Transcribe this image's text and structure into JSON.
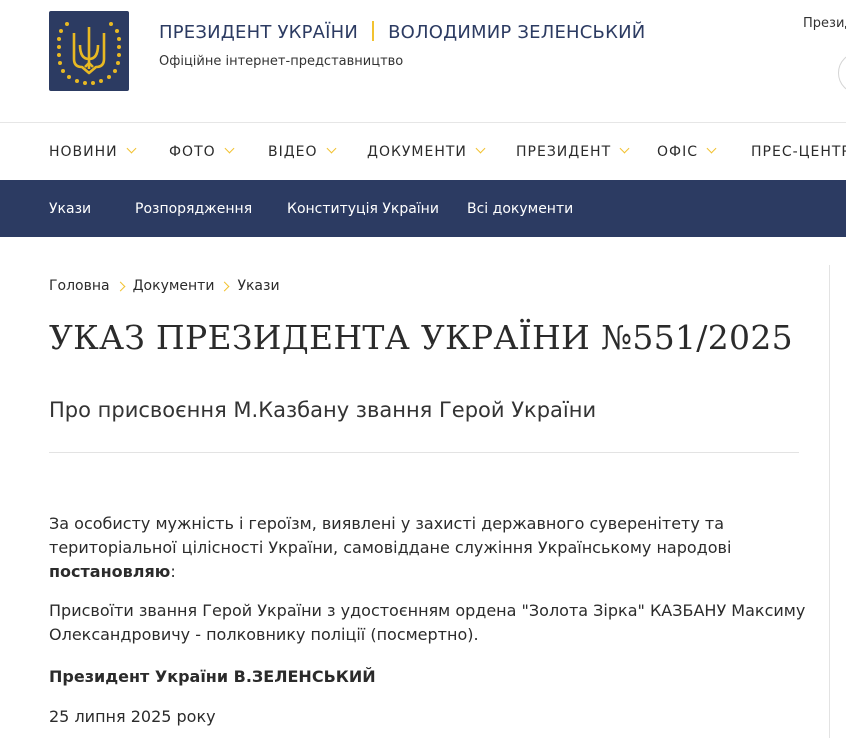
{
  "header": {
    "brand_left": "ПРЕЗИДЕНТ УКРАЇНИ",
    "brand_right": "ВОЛОДИМИР ЗЕЛЕНСЬКИЙ",
    "subtitle": "Офіційне інтернет-представництво",
    "top_right_text": "Презид"
  },
  "main_nav": [
    {
      "label": "НОВИНИ"
    },
    {
      "label": "ФОТО"
    },
    {
      "label": "ВІДЕО"
    },
    {
      "label": "ДОКУМЕНТИ"
    },
    {
      "label": "ПРЕЗИДЕНТ"
    },
    {
      "label": "ОФІС"
    },
    {
      "label": "ПРЕС-ЦЕНТР"
    }
  ],
  "sub_nav": [
    {
      "label": "Укази"
    },
    {
      "label": "Розпорядження"
    },
    {
      "label": "Конституція України"
    },
    {
      "label": "Всі документи"
    }
  ],
  "breadcrumb": [
    "Головна",
    "Документи",
    "Укази"
  ],
  "document": {
    "title": "УКАЗ ПРЕЗИДЕНТА УКРАЇНИ №551/2025",
    "subtitle": "Про присвоєння М.Казбану звання Герой України",
    "p1_text": "За особисту мужність і героїзм, виявлені у захисті державного суверенітету та територіальної цілісності України, самовіддане служіння Українському народові ",
    "p1_bold": "постановляю",
    "p1_end": ":",
    "p2": "Присвоїти звання Герой України з удостоєнням ордена \"Золота Зірка\" КАЗБАНУ Максиму Олександровичу - полковнику поліції (посмертно).",
    "signature": "Президент України В.ЗЕЛЕНСЬКИЙ",
    "date": "25 липня 2025 року"
  },
  "colors": {
    "navy": "#2c3b62",
    "accent_gold": "#f2c230"
  }
}
